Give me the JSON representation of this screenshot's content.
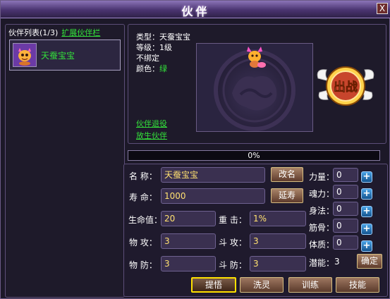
{
  "window": {
    "title": "伙伴",
    "close_label": "X"
  },
  "list": {
    "header": "伙伴列表(1/3)",
    "expand_link": "扩展伙伴栏",
    "items": [
      {
        "name": "天蚕宝宝"
      }
    ]
  },
  "info": {
    "type_line": "类型：天蚕宝宝",
    "level_line": "等级：1级",
    "bind_line": "不绑定",
    "color_label": "颜色：",
    "color_value": "绿",
    "retire_link": "伙伴退役",
    "release_link": "放生伙伴",
    "fight_label": "出战"
  },
  "progress": {
    "text": "0%",
    "fraction": 0
  },
  "attributes": {
    "name_label": "名  称：",
    "name_value": "天蚕宝宝",
    "rename_button": "改名",
    "life_label": "寿  命：",
    "life_value": "1000",
    "extend_button": "延寿",
    "hp_label": "生命值：",
    "hp_value": "20",
    "crit_label": "重  击：",
    "crit_value": "1%",
    "patk_label": "物  攻：",
    "patk_value": "3",
    "datk_label": "斗  攻：",
    "datk_value": "3",
    "pdef_label": "物  防：",
    "pdef_value": "3",
    "ddef_label": "斗  防：",
    "ddef_value": "3"
  },
  "stats": {
    "items": [
      {
        "label": "力量：",
        "value": "0"
      },
      {
        "label": "魂力：",
        "value": "0"
      },
      {
        "label": "身法：",
        "value": "0"
      },
      {
        "label": "筋骨：",
        "value": "0"
      },
      {
        "label": "体质：",
        "value": "0"
      }
    ],
    "potential_label": "潜能：",
    "potential_value": "3",
    "confirm_button": "确定",
    "plus_glyph": "+"
  },
  "tabs": [
    {
      "label": "提悟",
      "active": true
    },
    {
      "label": "洗灵",
      "active": false
    },
    {
      "label": "训练",
      "active": false
    },
    {
      "label": "技能",
      "active": false
    }
  ],
  "colors": {
    "accent_green": "#33e13a",
    "value_yellow": "#ffe070",
    "tab_highlight": "#ffe100"
  }
}
